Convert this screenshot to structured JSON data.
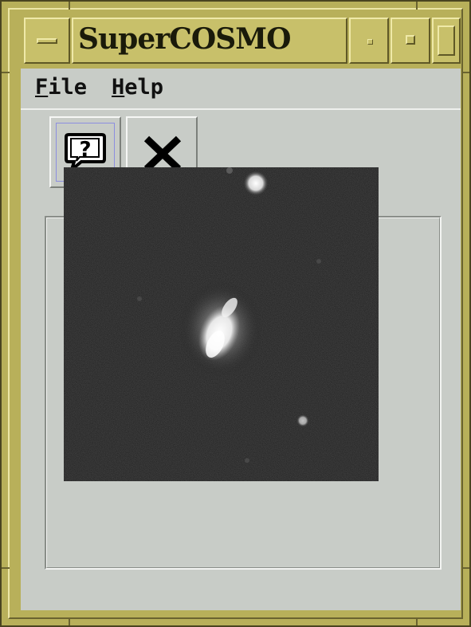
{
  "window": {
    "title": "SuperCOSMO",
    "frame_color": "#b8b05a"
  },
  "titlebar": {
    "menu_button_icon": "window-menu-icon",
    "minimize_icon": "minimize-icon",
    "maximize_icon": "maximize-icon",
    "close_icon": "close-icon"
  },
  "menubar": {
    "file": {
      "mnemonic": "F",
      "rest": "ile"
    },
    "help": {
      "mnemonic": "H",
      "rest": "elp"
    }
  },
  "toolbar": {
    "help_icon": "help-bubble-icon",
    "exit_icon": "exit-x-icon"
  },
  "image": {
    "subject": "galaxy-cutout",
    "background_color": "#141414"
  }
}
